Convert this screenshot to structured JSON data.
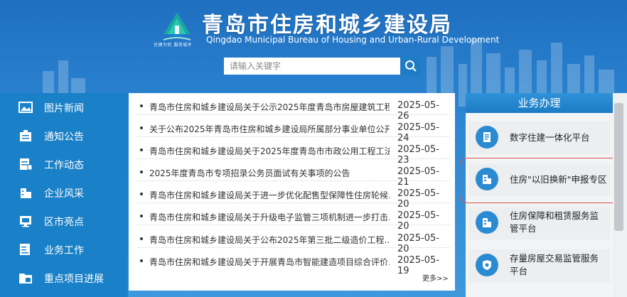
{
  "header": {
    "title": "青岛市住房和城乡建设局",
    "subtitle": "Qingdao Municipal Bureau of Housing and Urban-Rural Development",
    "slogan": "住建为民 服务城乡"
  },
  "search": {
    "placeholder": "请输入关键字",
    "icon": "search-icon"
  },
  "nav": {
    "items": [
      {
        "label": "图片新闻",
        "icon": "image-icon"
      },
      {
        "label": "通知公告",
        "icon": "notice-icon"
      },
      {
        "label": "工作动态",
        "icon": "document-icon"
      },
      {
        "label": "企业风采",
        "icon": "building-icon"
      },
      {
        "label": "区市亮点",
        "icon": "district-icon"
      },
      {
        "label": "业务工作",
        "icon": "briefcase-icon"
      },
      {
        "label": "重点项目进展",
        "icon": "folder-icon"
      }
    ]
  },
  "news": {
    "items": [
      {
        "title": "青岛市住房和城乡建设局关于公示2025年度青岛市房屋建筑工程..",
        "date": "2025-05-26"
      },
      {
        "title": "关于公布2025年青岛市住房和城乡建设局所属部分事业单位公开..",
        "date": "2025-05-24"
      },
      {
        "title": "青岛市住房和城乡建设局关于2025年度青岛市市政公用工程工法..",
        "date": "2025-05-23"
      },
      {
        "title": "2025年度青岛市专项招录公务员面试有关事项的公告",
        "date": "2025-05-21"
      },
      {
        "title": "青岛市住房和城乡建设局关于进一步优化配售型保障性住房轮候..",
        "date": "2025-05-20"
      },
      {
        "title": "青岛市住房和城乡建设局关于升级电子监管三项机制进一步打击..",
        "date": "2025-05-20"
      },
      {
        "title": "青岛市住房和城乡建设局关于公布2025年第三批二级造价工程..",
        "date": "2025-05-20"
      },
      {
        "title": "青岛市住房和城乡建设局关于开展青岛市智能建造项目综合评价..",
        "date": "2025-05-19"
      }
    ],
    "more_label": "更多>>"
  },
  "business": {
    "title": "业务办理",
    "items": [
      {
        "line1": "数字住建一体化平台",
        "line2": "",
        "icon": "platform-icon"
      },
      {
        "line1": "住房\"以旧换新\"申报专区",
        "line2": "",
        "icon": "housing-icon"
      },
      {
        "line1": "住房保障和租赁服务监",
        "line2": "管平台",
        "icon": "rental-icon"
      },
      {
        "line1": "存量房屋交易监管服务",
        "line2": "平台",
        "icon": "shield-icon"
      }
    ]
  },
  "colors": {
    "header_bg": "#2c86d2",
    "nav_bg": "#1a80c7",
    "accent": "#2b8bd2",
    "highlight": "#d9534f"
  }
}
